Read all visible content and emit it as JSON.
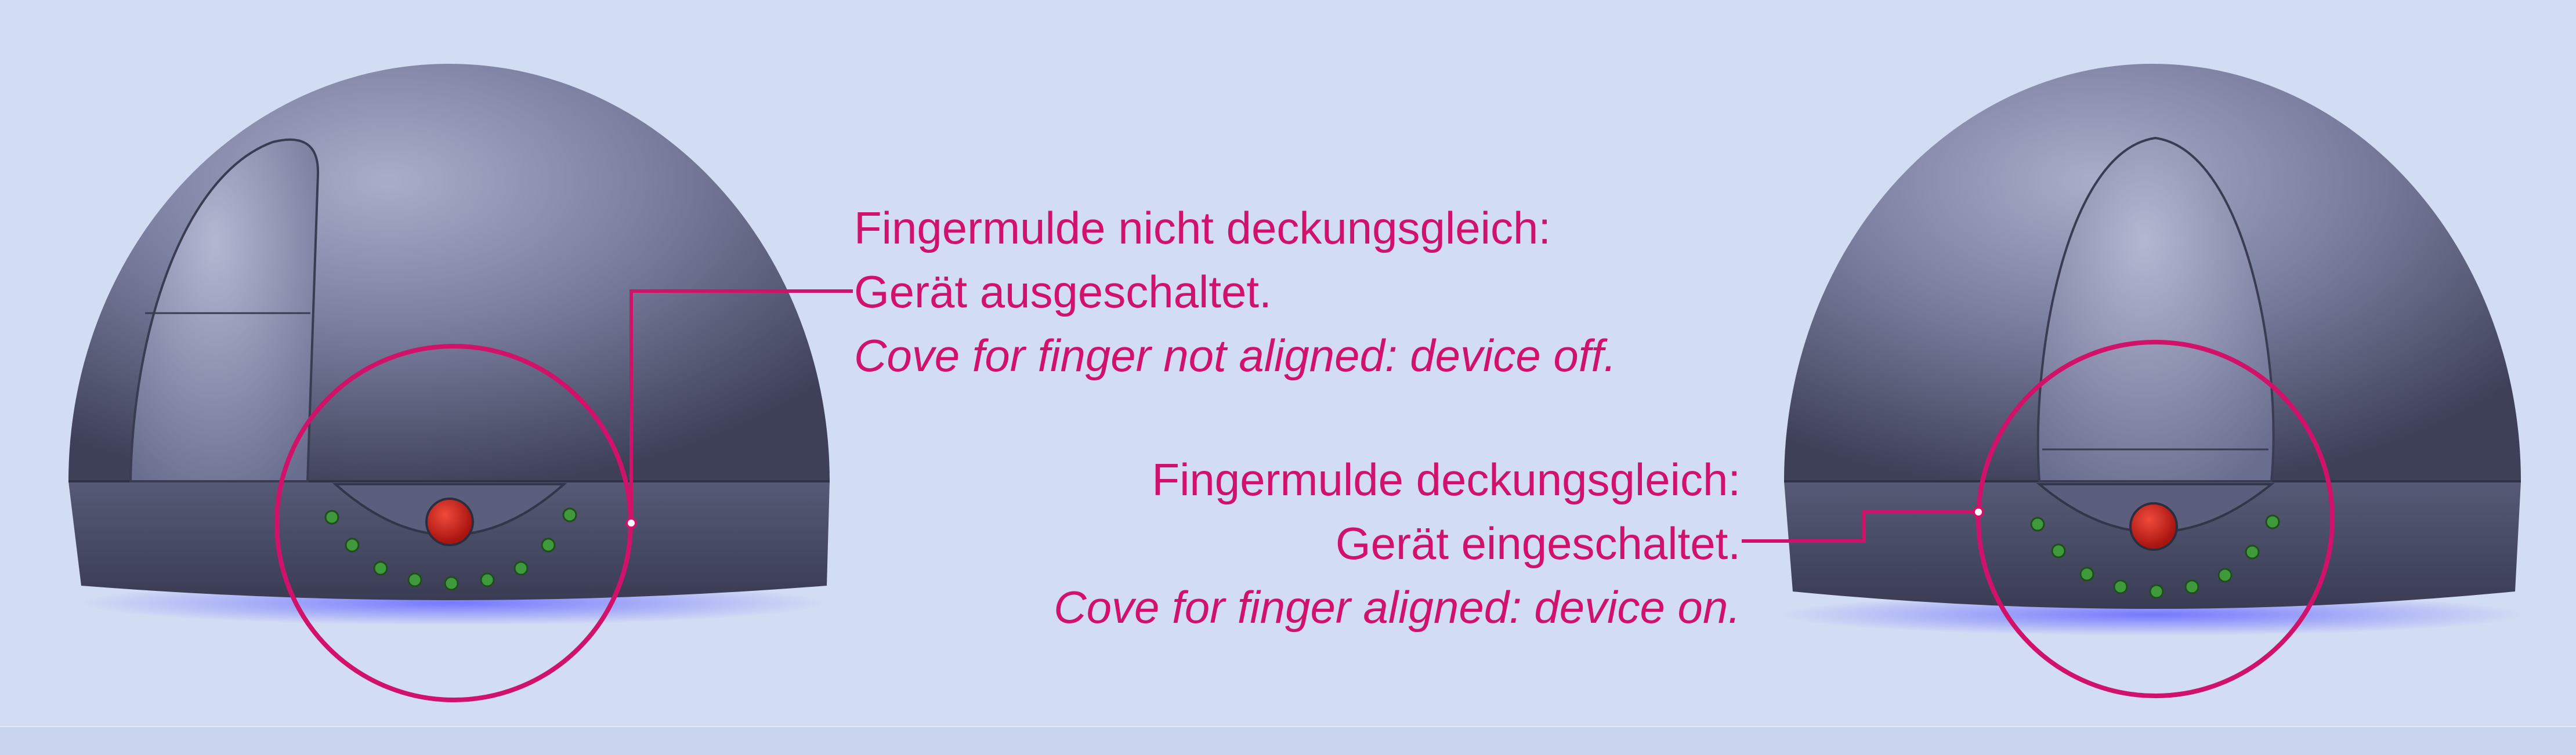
{
  "accent_color": "#d0126a",
  "background_color": "#d2dcf3",
  "device_body_color": "#6d7190",
  "indicator_led_color": "#d62a22",
  "status_dot_color": "#3f9a3c",
  "captions": {
    "off": {
      "de_line1": "Fingermulde nicht deckungsgleich:",
      "de_line2": "Gerät ausgeschaltet.",
      "en": "Cove for finger not aligned: device off."
    },
    "on": {
      "de_line1": "Fingermulde deckungsgleich:",
      "de_line2": "Gerät eingeschaltet.",
      "en": "Cove for finger aligned: device on."
    }
  }
}
